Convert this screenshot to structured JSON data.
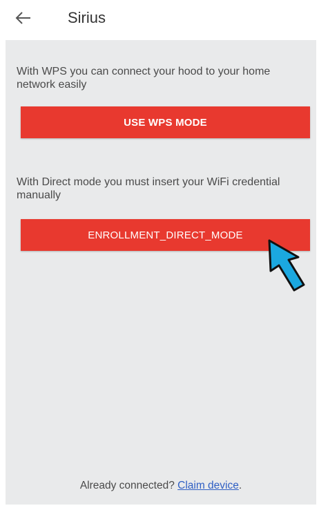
{
  "header": {
    "back_icon": "arrow-left-icon",
    "title": "Sirius"
  },
  "wps": {
    "description": "With WPS you can connect your hood to your home network easily",
    "button_label": "USE WPS MODE"
  },
  "direct": {
    "description": "With Direct mode you must insert your WiFi credential manually",
    "button_label": "ENROLLMENT_DIRECT_MODE"
  },
  "pointer": {
    "icon": "pointer-arrow-icon",
    "color": "#1ba8e0"
  },
  "footer": {
    "prompt": "Already connected?",
    "link_label": "Claim device",
    "trailing": "."
  },
  "colors": {
    "accent": "#e8392f",
    "background": "#e9eaeb",
    "link": "#2f5fc4"
  }
}
